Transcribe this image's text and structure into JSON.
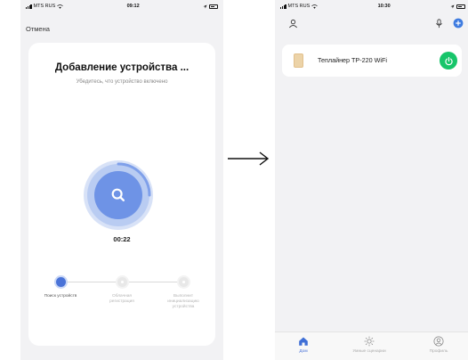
{
  "left_screen": {
    "status": {
      "carrier": "MTS RUS",
      "time": "09:12"
    },
    "cancel_label": "Отмена",
    "title": "Добавление устройства ...",
    "subtitle": "Убедитесь, что устройство включено",
    "timer": "00:22",
    "steps": [
      {
        "label": "Поиск устройств",
        "state": "active"
      },
      {
        "label": "Облачная регистрация",
        "state": "pending"
      },
      {
        "label": "Выполнит инициализацию устройства",
        "state": "pending"
      }
    ]
  },
  "right_screen": {
    "status": {
      "carrier": "MTS RUS",
      "time": "10:30"
    },
    "device": {
      "name": "Теплайнер ТР-220 WiFi",
      "power_on": true
    },
    "tabs": [
      {
        "label": "Дом",
        "icon": "home-icon",
        "active": true
      },
      {
        "label": "Умные сценарии",
        "icon": "sun-icon",
        "active": false
      },
      {
        "label": "Профиль",
        "icon": "profile-icon",
        "active": false
      }
    ]
  },
  "colors": {
    "accent": "#4a73d8",
    "power": "#17c56a",
    "background": "#f2f2f4"
  }
}
